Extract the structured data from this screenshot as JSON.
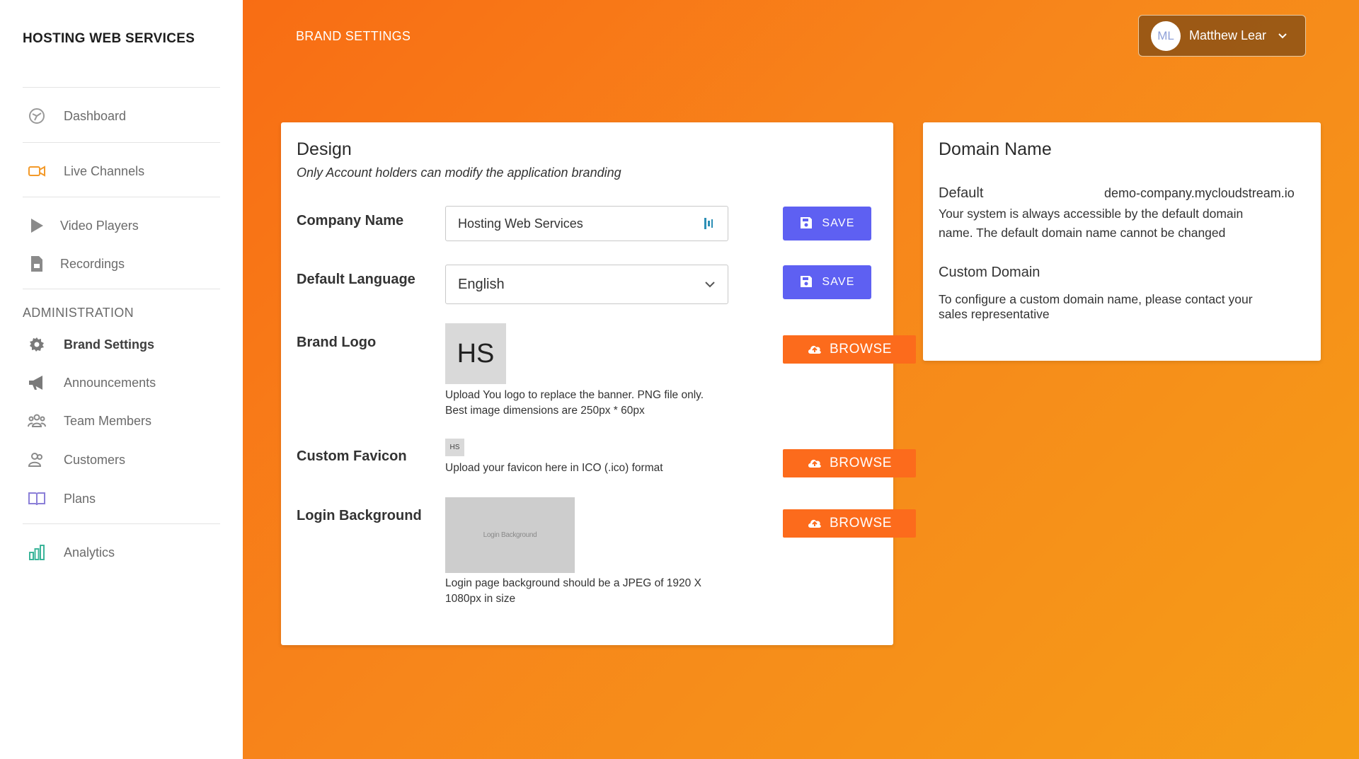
{
  "sidebar": {
    "brand": "HOSTING WEB SERVICES",
    "section_title": "ADMINISTRATION",
    "items": [
      {
        "label": "Dashboard",
        "icon": "dashboard-icon"
      },
      {
        "label": "Live Channels",
        "icon": "video-camera-icon"
      },
      {
        "label": "Video Players",
        "icon": "play-icon"
      },
      {
        "label": "Recordings",
        "icon": "file-icon"
      },
      {
        "label": "Brand Settings",
        "icon": "gear-icon",
        "active": true
      },
      {
        "label": "Announcements",
        "icon": "megaphone-icon"
      },
      {
        "label": "Team Members",
        "icon": "team-icon"
      },
      {
        "label": "Customers",
        "icon": "users-icon"
      },
      {
        "label": "Plans",
        "icon": "book-icon"
      },
      {
        "label": "Analytics",
        "icon": "bar-chart-icon"
      }
    ]
  },
  "header": {
    "title": "BRAND SETTINGS",
    "user": {
      "initials": "ML",
      "name": "Matthew Lear"
    }
  },
  "design": {
    "title": "Design",
    "subtitle": "Only Account holders can modify the application branding",
    "company_name": {
      "label": "Company Name",
      "value": "Hosting Web Services",
      "button": "SAVE"
    },
    "default_language": {
      "label": "Default Language",
      "value": "English",
      "button": "SAVE"
    },
    "brand_logo": {
      "label": "Brand Logo",
      "preview": "HS",
      "help_line1": "Upload You logo to replace the banner. PNG file only.",
      "help_line2": "Best image dimensions are 250px * 60px",
      "button": "BROWSE"
    },
    "custom_favicon": {
      "label": "Custom Favicon",
      "preview": "HS",
      "help": "Upload your favicon here in ICO (.ico) format",
      "button": "BROWSE"
    },
    "login_background": {
      "label": "Login Background",
      "preview": "Login Background",
      "help_line1": "Login page background should be a JPEG of 1920 X",
      "help_line2": "1080px in size",
      "button": "BROWSE"
    }
  },
  "domain": {
    "title": "Domain Name",
    "default_label": "Default",
    "default_value": "demo-company.mycloudstream.io",
    "default_help_line1": "Your system is always accessible by the default domain",
    "default_help_line2": "name. The default domain name cannot be changed",
    "custom_label": "Custom Domain",
    "custom_help_line1": "To configure a custom domain name, please contact your",
    "custom_help_line2": "sales representative"
  },
  "colors": {
    "accent_save": "#5e60f2",
    "accent_browse": "#fc6b1c",
    "gradient_start": "#f86d14",
    "gradient_end": "#f59d17"
  }
}
